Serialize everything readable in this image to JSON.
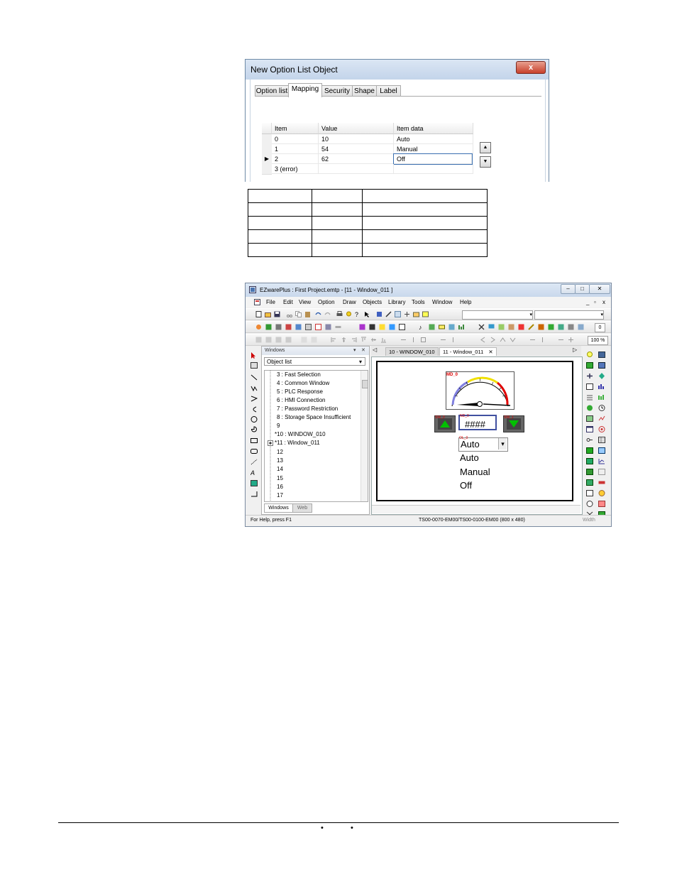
{
  "dialog": {
    "title": "New  Option List Object",
    "close_label": "x",
    "tabs": [
      "Option list",
      "Mapping",
      "Security",
      "Shape",
      "Label"
    ],
    "active_tab": "Mapping",
    "grid": {
      "columns": [
        "Item",
        "Value",
        "Item data"
      ],
      "rows": [
        {
          "item": "0",
          "value": "10",
          "data": "Auto"
        },
        {
          "item": "1",
          "value": "54",
          "data": "Manual"
        },
        {
          "item": "2",
          "value": "62",
          "data": "Off"
        },
        {
          "item": "3 (error)",
          "value": "",
          "data": ""
        }
      ],
      "current_row_marker": "▶"
    },
    "spin_up": "▲",
    "spin_down": "▼"
  },
  "app": {
    "title": "EZwarePlus : First Project.emtp - [11 - Window_011 ]",
    "window_buttons": {
      "minimize": "–",
      "maximize": "□",
      "close": "✕"
    },
    "mdi_buttons": {
      "minimize": "_",
      "restore": "▫",
      "close": "x"
    },
    "menus": [
      "File",
      "Edit",
      "View",
      "Option",
      "Draw",
      "Objects",
      "Library",
      "Tools",
      "Window",
      "Help"
    ],
    "zoom": "100 %",
    "toolbar_counter": "0",
    "windows_panel": {
      "header": "Windows",
      "pin": "▾",
      "close": "✕",
      "combo_value": "Object list",
      "combo_arrow": "▾",
      "tree": [
        "3 : Fast Selection",
        "4 : Common Window",
        "5 : PLC Response",
        "6 : HMI Connection",
        "7 : Password Restriction",
        "8 : Storage Space Insufficient",
        "9",
        "*10 : WINDOW_010",
        "*11 : Window_011",
        "12",
        "13",
        "14",
        "15",
        "16",
        "17"
      ],
      "bottom_tabs": [
        "Windows",
        "Web"
      ]
    },
    "doc_tabs": [
      "10 - WINDOW_010",
      "11 - Window_011"
    ],
    "doc_tab_close": "✕",
    "tab_nav_left": "◁",
    "tab_nav_right": "▷",
    "screen": {
      "meter_label": "MD_0",
      "numeric_label": "ND_0",
      "numeric_display": "####",
      "up_label": "SW_0",
      "down_label": "SW_1",
      "option_label": "OL_0",
      "option_selected": "Auto",
      "option_arrow": "▾",
      "option_items": [
        "Auto",
        "Manual",
        "Off"
      ]
    },
    "status": {
      "help": "For Help, press F1",
      "model": "TS00-0070-EM00/TS00-0100-EM00 (800 x 480)",
      "right": "Width"
    },
    "colors": {
      "title_bar": "#c9d8ec",
      "meter_red": "#e00000",
      "meter_yellow": "#f0e000",
      "meter_blue": "#8080e0",
      "button_green": "#00c000"
    }
  }
}
